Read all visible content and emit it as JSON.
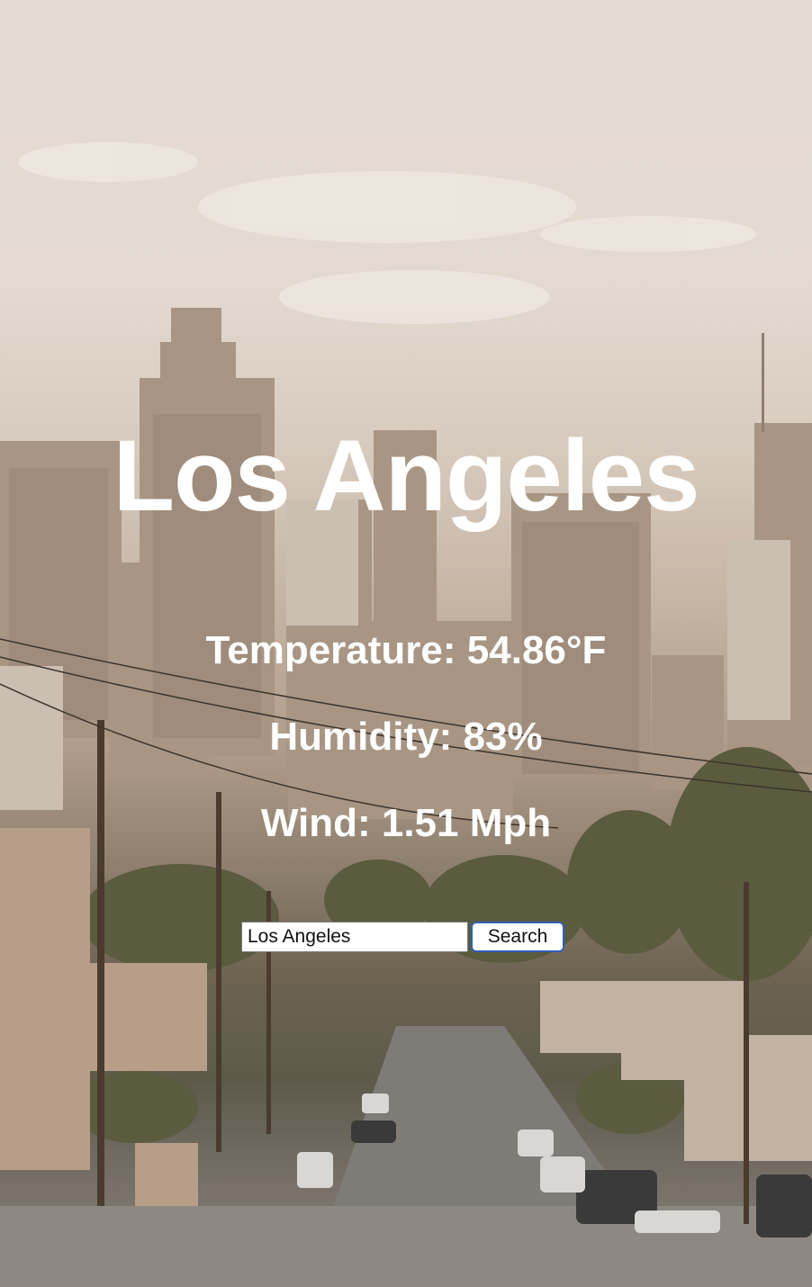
{
  "weather": {
    "city": "Los Angeles",
    "temperature": "Temperature: 54.86°F",
    "humidity": "Humidity: 83%",
    "wind": "Wind: 1.51 Mph"
  },
  "search": {
    "value": "Los Angeles",
    "button_label": "Search"
  },
  "colors": {
    "text": "#ffffff",
    "button_border": "#2f5fb8"
  }
}
